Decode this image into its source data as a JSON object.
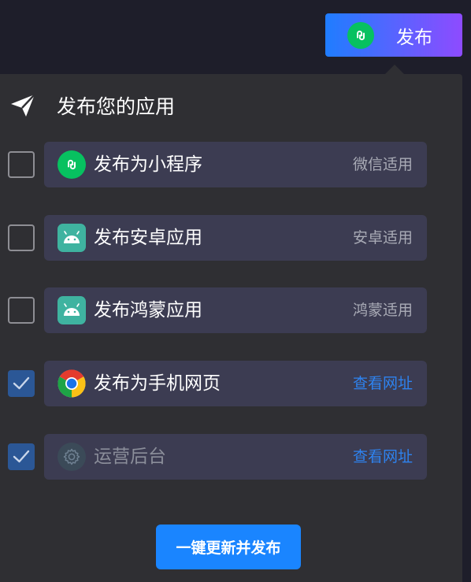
{
  "header": {
    "publish_button_label": "发布",
    "publish_button_icon": "wechat-miniprogram-icon"
  },
  "panel": {
    "title": "发布您的应用",
    "title_icon": "paper-plane-icon",
    "options": [
      {
        "label": "发布为小程序",
        "right_text": "微信适用",
        "checked": false,
        "icon": "wechat-miniprogram-icon",
        "right_is_link": false
      },
      {
        "label": "发布安卓应用",
        "right_text": "安卓适用",
        "checked": false,
        "icon": "android-icon",
        "right_is_link": false
      },
      {
        "label": "发布鸿蒙应用",
        "right_text": "鸿蒙适用",
        "checked": false,
        "icon": "android-icon",
        "right_is_link": false
      },
      {
        "label": "发布为手机网页",
        "right_text": "查看网址",
        "checked": true,
        "icon": "chrome-icon",
        "right_is_link": true
      },
      {
        "label": "运营后台",
        "right_text": "查看网址",
        "checked": true,
        "icon": "gear-icon",
        "right_is_link": true,
        "dimmed": true
      }
    ],
    "cta_label": "一键更新并发布"
  },
  "colors": {
    "background": "#1e1e2a",
    "panel": "#2f2f33",
    "card": "#3c3c52",
    "accent_blue": "#1a85ff",
    "link_blue": "#2e83f0",
    "gradient_start": "#1f7dff",
    "gradient_end": "#8e4bff",
    "wechat_green": "#07c160",
    "android_teal": "#3fb3a0",
    "checked_box": "#2b5796"
  }
}
